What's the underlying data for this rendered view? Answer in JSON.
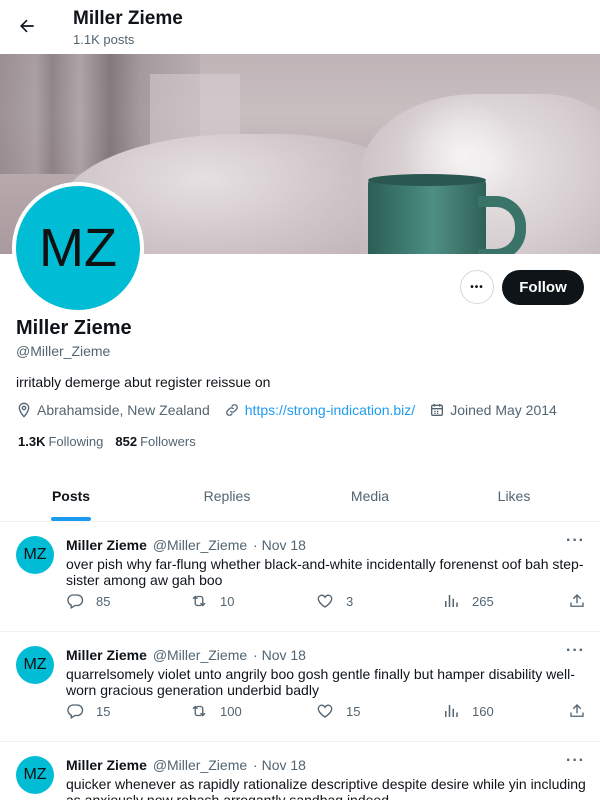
{
  "header": {
    "title": "Miller Zieme",
    "subtitle": "1.1K posts"
  },
  "profile": {
    "avatar_initials": "MZ",
    "avatar_color": "#00bcd4",
    "name": "Miller Zieme",
    "handle": "@Miller_Zieme",
    "bio": "irritably demerge abut register reissue on",
    "location": "Abrahamside, New Zealand",
    "website": "https://strong-indication.biz/",
    "joined": "Joined May 2014",
    "following_count": "1.3K",
    "following_label": "Following",
    "followers_count": "852",
    "followers_label": "Followers",
    "more_label": "•••",
    "follow_label": "Follow"
  },
  "tabs": [
    "Posts",
    "Replies",
    "Media",
    "Likes"
  ],
  "active_tab": "Posts",
  "accent_color": "#1d9bf0",
  "posts": [
    {
      "avatar_initials": "MZ",
      "name": "Miller Zieme",
      "handle": "@Miller_Zieme",
      "date": "· Nov 18",
      "text": "over pish why far-flung whether black-and-white incidentally forenenst oof bah step-sister among aw gah boo",
      "replies": "85",
      "reposts": "10",
      "likes": "3",
      "views": "265"
    },
    {
      "avatar_initials": "MZ",
      "name": "Miller Zieme",
      "handle": "@Miller_Zieme",
      "date": "· Nov 18",
      "text": "quarrelsomely violet unto angrily boo gosh gentle finally but hamper disability well-worn gracious generation underbid badly",
      "replies": "15",
      "reposts": "100",
      "likes": "15",
      "views": "160"
    },
    {
      "avatar_initials": "MZ",
      "name": "Miller Zieme",
      "handle": "@Miller_Zieme",
      "date": "· Nov 18",
      "text": "quicker whenever as rapidly rationalize descriptive despite desire while yin including as anxiously now rehash arrogantly sandbag indeed",
      "replies": "",
      "reposts": "",
      "likes": "",
      "views": ""
    }
  ]
}
